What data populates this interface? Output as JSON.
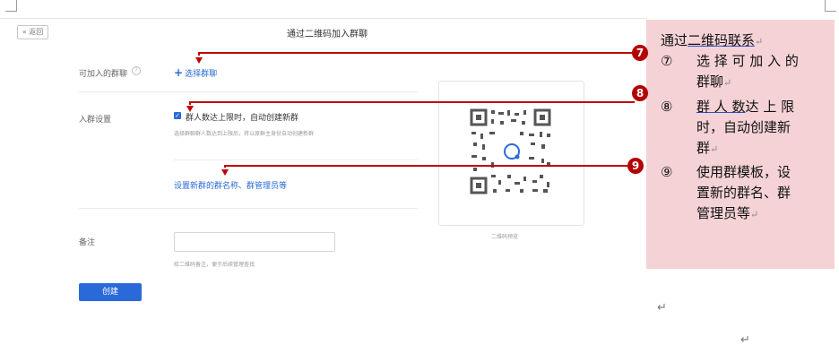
{
  "app": {
    "back_label": "« 返回",
    "title": "通过二维码加入群聊"
  },
  "form": {
    "groups_label": "可加入的群聊",
    "select_group_label": "选择群聊",
    "settings_label": "入群设置",
    "auto_create_label": "群人数达上限时，自动创建新群",
    "auto_create_checked": true,
    "auto_create_hint": "选择群聊群人数达到上限后，将以原群主身份自动创建新群",
    "set_new_group_label": "设置新群的群名称、群管理员等",
    "remark_label": "备注",
    "remark_value": "",
    "remark_hint": "给二维码备注，便于后续管理查找",
    "create_label": "创建"
  },
  "qr": {
    "preview_label": "二维码预览"
  },
  "annotation": {
    "intro_prefix": "通过",
    "intro_link": "二维码联系",
    "items": [
      {
        "num": "⑦",
        "text_line1": "选 择 可 加 入 的",
        "text_line2": "群聊"
      },
      {
        "num": "⑧",
        "link": "群 人 数",
        "text_line1_rest": "达 上 限",
        "text_line2": "时，自动创建新",
        "text_line3": "群"
      },
      {
        "num": "⑨",
        "text_line1": "使用群模板，设",
        "text_line2": "置新的群名、群",
        "text_line3": "管理员等"
      }
    ],
    "badges": [
      "7",
      "8",
      "9"
    ],
    "return_mark": "↵"
  },
  "colors": {
    "accent": "#2a6ad8",
    "annotation_bg": "#f4d2d6",
    "arrow": "#c00000"
  }
}
